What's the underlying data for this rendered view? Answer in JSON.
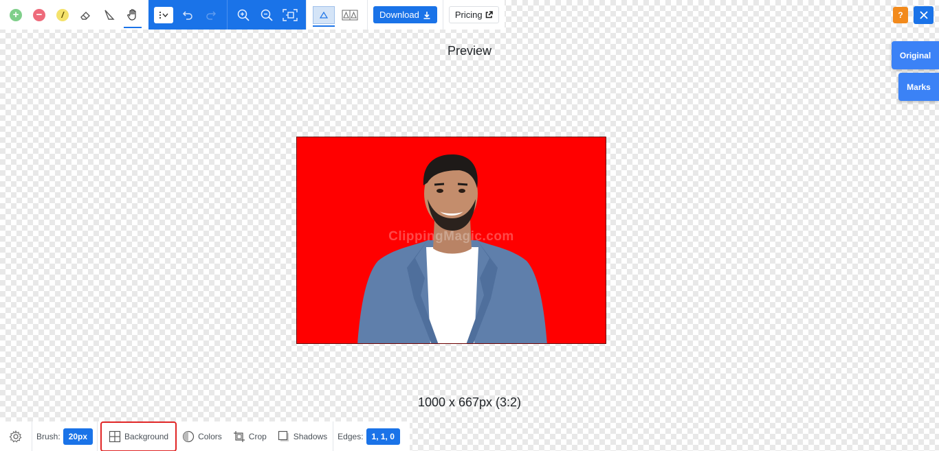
{
  "toolbar": {
    "download_label": "Download",
    "pricing_label": "Pricing"
  },
  "top_right": {
    "help_label": "?",
    "side_tabs": {
      "original": "Original",
      "marks": "Marks"
    }
  },
  "preview": {
    "title": "Preview",
    "watermark": "ClippingMagic.com",
    "dimensions": "1000 x 667px (3:2)",
    "background_color": "#ff0000"
  },
  "bottom_bar": {
    "brush_label": "Brush:",
    "brush_value": "20px",
    "background_label": "Background",
    "colors_label": "Colors",
    "crop_label": "Crop",
    "shadows_label": "Shadows",
    "edges_label": "Edges:",
    "edges_value": "1, 1, 0"
  },
  "colors": {
    "accent": "#1a73e8",
    "help": "#f28a1c",
    "highlight": "#e02424"
  }
}
